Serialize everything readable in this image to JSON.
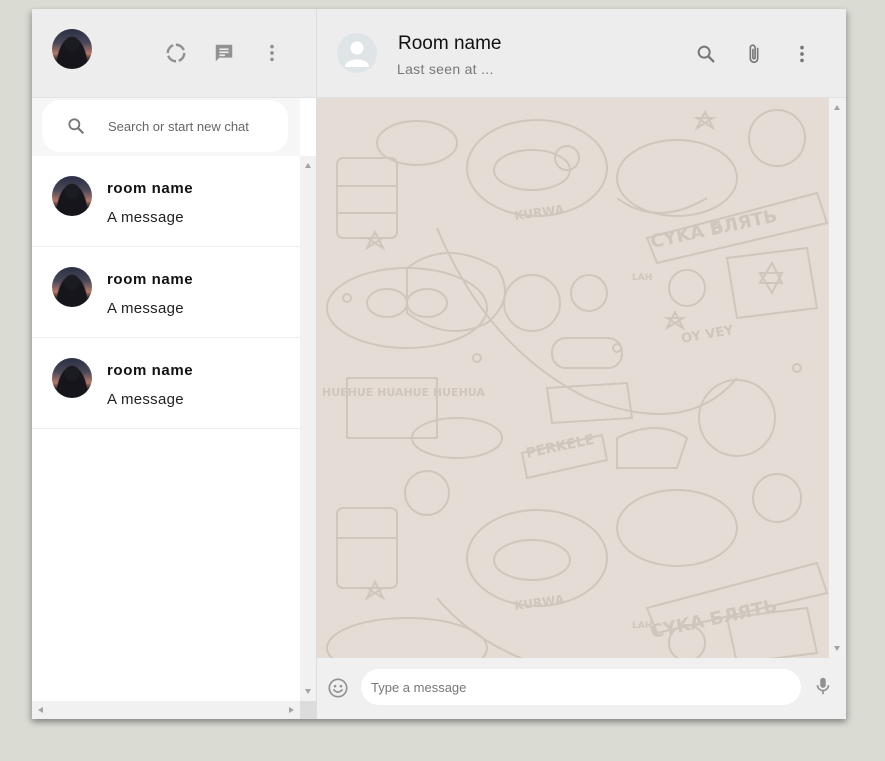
{
  "sidebar": {
    "search": {
      "placeholder": "Search or start new chat"
    },
    "header_icons": [
      "status-icon",
      "new-chat-icon",
      "menu-dots-icon"
    ],
    "chats": [
      {
        "name": "room name",
        "message": "A message"
      },
      {
        "name": "room name",
        "message": "A message"
      },
      {
        "name": "room name",
        "message": "A message"
      }
    ]
  },
  "chat": {
    "room_name": "Room name",
    "last_seen": "Last seen at ...",
    "header_icons": [
      "search-icon",
      "attach-icon",
      "menu-dots-icon"
    ],
    "doodle_text": [
      "KURWA",
      "CYKA БЛЯТЬ",
      "HUEHUE HUAHUE HUEHUA",
      "PERKELE",
      "OY VEY",
      "LAH"
    ],
    "input": {
      "placeholder": "Type a message"
    },
    "footer_icons": [
      "emoji-icon",
      "mic-icon"
    ]
  },
  "colors": {
    "app_background": "#dadbd3",
    "panel_header": "#ededed",
    "chat_background": "#e5ddd5",
    "icon_gray": "#919191"
  }
}
